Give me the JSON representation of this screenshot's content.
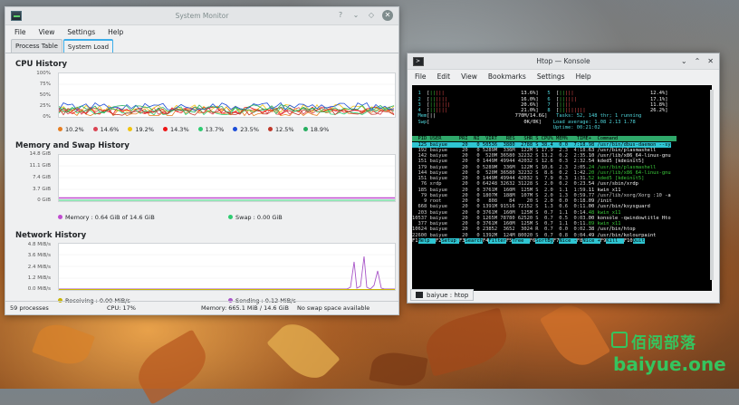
{
  "sysmon": {
    "title": "System Monitor",
    "menu": [
      "File",
      "View",
      "Settings",
      "Help"
    ],
    "tabs": [
      "Process Table",
      "System Load"
    ],
    "cpu": {
      "title": "CPU History",
      "yticks": [
        "100%",
        "75%",
        "50%",
        "25%",
        "0%"
      ],
      "legend": [
        {
          "label": "10.2%",
          "color": "#e67e22"
        },
        {
          "label": "14.6%",
          "color": "#da4453"
        },
        {
          "label": "19.2%",
          "color": "#f1c40f"
        },
        {
          "label": "14.3%",
          "color": "#ed1515"
        },
        {
          "label": "13.7%",
          "color": "#2ecc71"
        },
        {
          "label": "23.5%",
          "color": "#1d4ed8"
        },
        {
          "label": "12.5%",
          "color": "#c0392b"
        },
        {
          "label": "18.9%",
          "color": "#27ae60"
        }
      ]
    },
    "mem": {
      "title": "Memory and Swap History",
      "yticks": [
        "14.8 GiB",
        "11.1 GiB",
        "7.4 GiB",
        "3.7 GiB",
        "0 GiB"
      ],
      "memory_label": "Memory : 0.64 GiB of 14.6 GiB",
      "swap_label": "Swap : 0.00 GiB",
      "memory_color": "#c04bd0",
      "swap_color": "#2ecc71"
    },
    "net": {
      "title": "Network History",
      "yticks": [
        "4.8 MiB/s",
        "3.6 MiB/s",
        "2.4 MiB/s",
        "1.2 MiB/s",
        "0.0 MiB/s"
      ],
      "receiving_label": "Receiving : 0.00 MiB/s",
      "sending_label": "Sending : 0.12 MiB/s",
      "receiving_color": "#c8b400",
      "sending_color": "#a855c8"
    },
    "status": {
      "processes": "59 processes",
      "cpu": "CPU: 17%",
      "memory": "Memory: 665.1 MiB / 14.6 GiB",
      "swap": "No swap space available"
    }
  },
  "konsole": {
    "title": "Htop — Konsole",
    "menu": [
      "File",
      "Edit",
      "View",
      "Bookmarks",
      "Settings",
      "Help"
    ],
    "tab_label": "baiyue : htop",
    "meters_left": [
      {
        "n": "1",
        "bar": "[|||||",
        "pct": "13.6%]"
      },
      {
        "n": "2",
        "bar": "[||||||",
        "pct": "16.0%]"
      },
      {
        "n": "3",
        "bar": "[|||||||",
        "pct": "20.6%]"
      },
      {
        "n": "4",
        "bar": "[||||||",
        "pct": "21.0%]"
      }
    ],
    "meters_right": [
      {
        "n": "5",
        "bar": "[|||||",
        "pct": "12.4%]"
      },
      {
        "n": "6",
        "bar": "[||||||",
        "pct": "17.1%]"
      },
      {
        "n": "7",
        "bar": "[||||",
        "pct": "11.8%]"
      },
      {
        "n": "8",
        "bar": "[|||||||||",
        "pct": "26.2%]"
      }
    ],
    "mem_line": "Mem[||                           770M/14.6G]",
    "swp_line": "Swp[                                0K/0K]",
    "tasks": "Tasks: 52, 148 thr; 1 running",
    "load": "Load average: 1.08 2.13 1.78",
    "uptime": "Uptime: 00:21:02",
    "header": "  PID USER      PRI  NI  VIRT   RES   SHR S CPU% MEM%   TIME+  Command",
    "rows": [
      {
        "text": "  125 baiyue     20   0 50536  3880  2788 S 38.4  0.0  7:18.98 /usr/bin/dbus-daemon --sy",
        "style": "sel"
      },
      {
        "text": "  192 baiyue     20   0 5289M  336M  122M S 17.9  2.3  4:18.63 /usr/bin/plasmashell",
        "style": ""
      },
      {
        "text": "  142 baiyue     20   0  520M 36580 32232 S 13.2  0.2  2:35.10 /usr/lib/x86_64-linux-gnu",
        "style": ""
      },
      {
        "text": "  151 baiyue     20   0 1449M 49944 42032 S 12.6  0.3  2:32.54 kded5 [kdeinit5]",
        "style": ""
      },
      {
        "text": "  179 baiyue     20   0 5289M  336M  122M S 10.6  2.3  2:05.24 /usr/bin/plasmashell",
        "style": "gcmd"
      },
      {
        "text": "  144 baiyue     20   0  520M 36580 32232 S  8.6  0.2  1:42.20 /usr/lib/x86_64-linux-gnu",
        "style": "gcmd"
      },
      {
        "text": "  151 baiyue     20   0 1449M 49944 42032 S  7.9  0.3  1:31.52 kded5 [kdeinit5]",
        "style": "gcmd"
      },
      {
        "text": "   76 xrdp       20   0 64248 32632 31228 S  2.0  0.2  0:23.54 /usr/sbin/xrdp",
        "style": "dimuser"
      },
      {
        "text": "  185 baiyue     20   0 3761M  160M  125M S  2.0  1.1  1:59.11 kwin_x11",
        "style": ""
      },
      {
        "text": "   79 baiyue     20   0 1807M  188M  107M S  2.0  1.3  0:59.77 /usr/lib/xorg/Xorg :10 -a",
        "style": ""
      },
      {
        "text": "    9 root       20   0   808    84    20 S  2.0  0.0  0:18.09 /init",
        "style": "dimuser"
      },
      {
        "text": "  668 baiyue     20   0 1391M 91516 72152 S  1.3  0.6  0:11.00 /usr/bin/ksysguard",
        "style": ""
      },
      {
        "text": "  203 baiyue     20   0 3761M  160M  125M S  0.7  1.1  0:14.48 kwin_x11",
        "style": "gcmd"
      },
      {
        "text": "10537 baiyue     20   0 1265M 78780 62520 S  0.7  0.5  0:03.00 konsole -qwindowtitle Hto",
        "style": ""
      },
      {
        "text": "  377 baiyue     20   0 3761M  160M  125M S  0.7  1.1  0:11.89 kwin_x11",
        "style": "gcmd"
      },
      {
        "text": "10624 baiyue     20   0 23852  3652  3024 R  0.7  0.0  0:02.38 /usr/bin/htop",
        "style": ""
      },
      {
        "text": "22600 baiyue     20   0 1392M  124M 80020 S  0.7  0.8  0:04.49 /usr/bin/kolourpaint",
        "style": ""
      }
    ],
    "fkeys": [
      {
        "k": "F1",
        "l": "Help  "
      },
      {
        "k": "F2",
        "l": "Setup "
      },
      {
        "k": "F3",
        "l": "Search"
      },
      {
        "k": "F4",
        "l": "Filter"
      },
      {
        "k": "F5",
        "l": "Tree  "
      },
      {
        "k": "F6",
        "l": "SortBy"
      },
      {
        "k": "F7",
        "l": "Nice -"
      },
      {
        "k": "F8",
        "l": "Nice +"
      },
      {
        "k": "F9",
        "l": "Kill  "
      },
      {
        "k": "F10",
        "l": "Quit"
      }
    ]
  },
  "watermark": {
    "cn": "佰阅部落",
    "en": "baiyue.one",
    "color": "#35c45e"
  }
}
